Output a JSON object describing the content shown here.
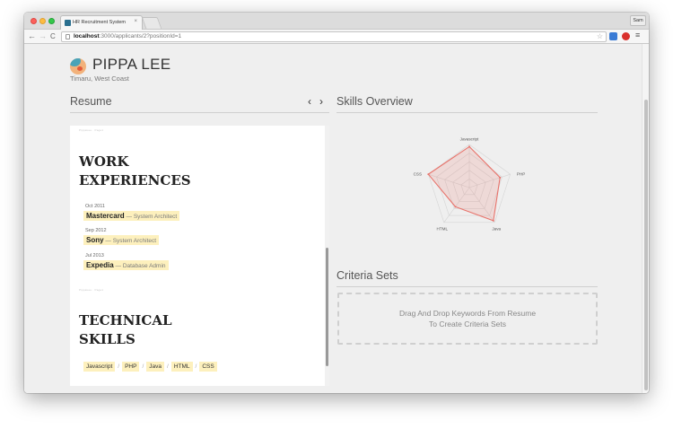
{
  "browser": {
    "tab_title": "HR Recruitment System",
    "tab_close": "×",
    "profile_name": "Sam",
    "url_host": "localhost",
    "url_rest": ":3000/applicants/2?positionId=1",
    "icons": {
      "back": "arrow-left-icon",
      "forward": "arrow-right-icon",
      "reload": "reload-icon",
      "bookmark": "star-icon",
      "menu": "hamburger-menu-icon"
    }
  },
  "applicant": {
    "name": "PIPPA LEE",
    "location": "Timaru, West Coast"
  },
  "resume": {
    "title": "Resume",
    "prev": "‹",
    "next": "›",
    "page_header": "PippaLee · Page1",
    "work_heading": "WORK EXPERIENCES",
    "experiences": [
      {
        "date": "Oct 2011",
        "company": "Mastercard",
        "role": "System Architect"
      },
      {
        "date": "Sep 2012",
        "company": "Sony",
        "role": "System Architect"
      },
      {
        "date": "Jul 2013",
        "company": "Expedia",
        "role": "Database Admin"
      }
    ],
    "separator": "—",
    "tech_heading": "TECHNICAL SKILLS",
    "skills": [
      "Javascript",
      "PHP",
      "Java",
      "HTML",
      "CSS"
    ],
    "skill_separator": "/"
  },
  "skills_overview": {
    "title": "Skills Overview"
  },
  "chart_data": {
    "type": "radar",
    "axes": [
      "Javascript",
      "PHP",
      "Java",
      "HTML",
      "CSS"
    ],
    "series": [
      {
        "values": [
          0.95,
          0.75,
          0.95,
          0.55,
          1.0
        ]
      }
    ],
    "grid_levels": 5,
    "series_color": "#e8736b",
    "grid_color": "#d4d4d4"
  },
  "criteria_sets": {
    "title": "Criteria Sets",
    "drop_line1": "Drag And Drop Keywords From Resume",
    "drop_line2": "To Create Criteria Sets"
  },
  "colors": {
    "highlight": "#fdf0bd",
    "page_bg": "#efefef",
    "accent_red": "#e8736b"
  }
}
